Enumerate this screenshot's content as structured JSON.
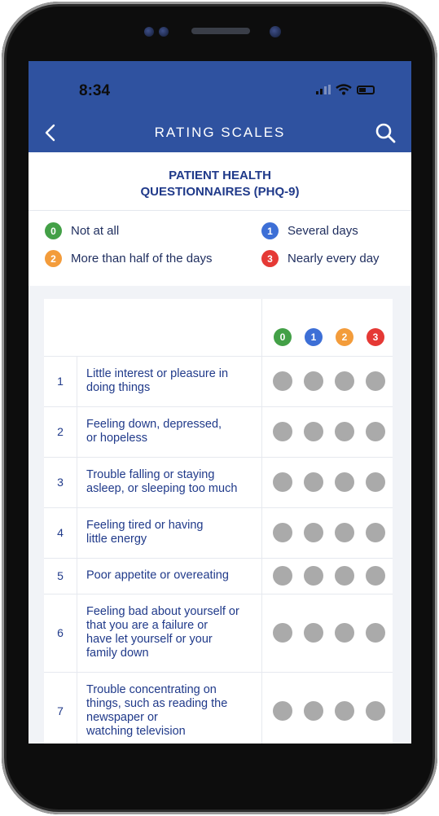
{
  "status_bar": {
    "time": "8:34"
  },
  "nav": {
    "title": "RATING SCALES",
    "back_icon": "chevron-left-icon",
    "search_icon": "search-icon"
  },
  "header": {
    "title_line1": "PATIENT HEALTH",
    "title_line2": "QUESTIONNAIRES (PHQ-9)"
  },
  "colors": {
    "header_bg": "#2f52a0",
    "score_0": "#43a047",
    "score_1": "#3d6fd6",
    "score_2": "#f39c3b",
    "score_3": "#e53935",
    "radio_unselected": "#aaaaaa",
    "text": "#203a8a"
  },
  "legend": [
    {
      "value": "0",
      "label": "Not at all"
    },
    {
      "value": "1",
      "label": "Several days"
    },
    {
      "value": "2",
      "label": "More than half of the days"
    },
    {
      "value": "3",
      "label": "Nearly every day"
    }
  ],
  "table": {
    "score_headers": [
      "0",
      "1",
      "2",
      "3"
    ],
    "rows": [
      {
        "num": "1",
        "text": "Little interest or pleasure in\ndoing things"
      },
      {
        "num": "2",
        "text": "Feeling down, depressed,\nor hopeless"
      },
      {
        "num": "3",
        "text": "Trouble falling or staying\nasleep, or sleeping too much"
      },
      {
        "num": "4",
        "text": "Feeling tired or having\nlittle energy"
      },
      {
        "num": "5",
        "text": "Poor appetite or overeating"
      },
      {
        "num": "6",
        "text": "Feeling bad about yourself or\nthat you are a failure or\nhave let yourself or your\nfamily down"
      },
      {
        "num": "7",
        "text": "Trouble concentrating on\nthings, such as reading the\nnewspaper or\nwatching television"
      }
    ]
  }
}
